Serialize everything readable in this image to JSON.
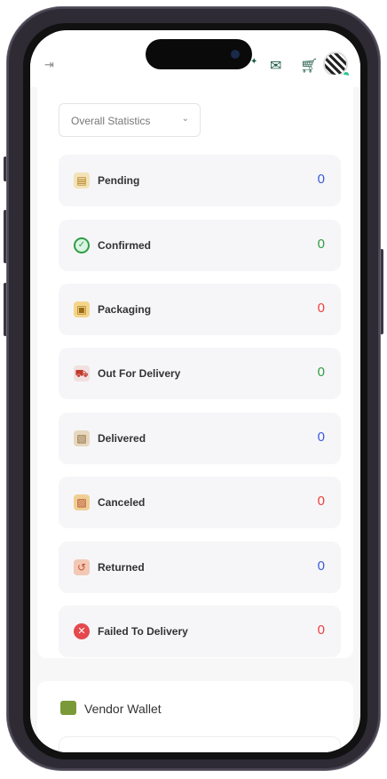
{
  "header": {
    "collapse_icon": "⇥",
    "icons": [
      "notification-icon",
      "chat-icon",
      "cart-icon"
    ],
    "avatar": "qr-avatar"
  },
  "filter": {
    "selected": "Overall Statistics"
  },
  "stats": [
    {
      "label": "Pending",
      "value": "0",
      "icon": "clipboard-icon",
      "color": "#3b5bdb"
    },
    {
      "label": "Confirmed",
      "value": "0",
      "icon": "check-circle-icon",
      "color": "#2f9e44"
    },
    {
      "label": "Packaging",
      "value": "0",
      "icon": "package-icon",
      "color": "#f03e3e"
    },
    {
      "label": "Out For Delivery",
      "value": "0",
      "icon": "truck-icon",
      "color": "#2f9e44"
    },
    {
      "label": "Delivered",
      "value": "0",
      "icon": "box-delivered-icon",
      "color": "#3b5bdb"
    },
    {
      "label": "Canceled",
      "value": "0",
      "icon": "box-canceled-icon",
      "color": "#f03e3e"
    },
    {
      "label": "Returned",
      "value": "0",
      "icon": "return-box-icon",
      "color": "#3b5bdb"
    },
    {
      "label": "Failed To Delivery",
      "value": "0",
      "icon": "failed-icon",
      "color": "#f03e3e"
    }
  ],
  "wallet": {
    "title": "Vendor Wallet"
  }
}
